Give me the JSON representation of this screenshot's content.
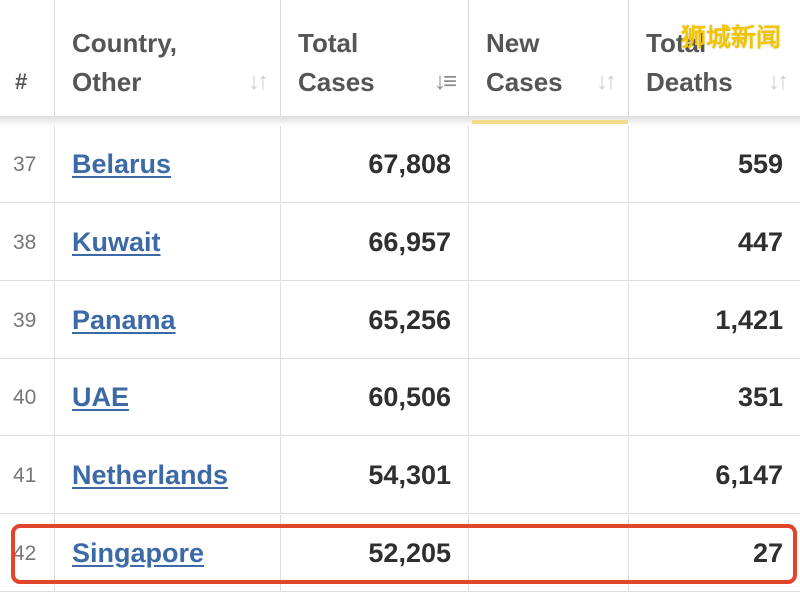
{
  "header": {
    "rank": "#",
    "country": "Country,\nOther",
    "total_cases": "Total\nCases",
    "new_cases": "New\nCases",
    "total_deaths": "Total\nDeaths",
    "sort_icon": "↓↑",
    "sort_icon_active": "↓≡"
  },
  "rows": [
    {
      "rank": "37",
      "country": "Belarus",
      "total_cases": "67,808",
      "new_cases": "",
      "total_deaths": "559"
    },
    {
      "rank": "38",
      "country": "Kuwait",
      "total_cases": "66,957",
      "new_cases": "",
      "total_deaths": "447"
    },
    {
      "rank": "39",
      "country": "Panama",
      "total_cases": "65,256",
      "new_cases": "",
      "total_deaths": "1,421"
    },
    {
      "rank": "40",
      "country": "UAE",
      "total_cases": "60,506",
      "new_cases": "",
      "total_deaths": "351"
    },
    {
      "rank": "41",
      "country": "Netherlands",
      "total_cases": "54,301",
      "new_cases": "",
      "total_deaths": "6,147"
    },
    {
      "rank": "42",
      "country": "Singapore",
      "total_cases": "52,205",
      "new_cases": "",
      "total_deaths": "27"
    }
  ],
  "highlight_color": "#e2452c",
  "link_color": "#3c6aa6",
  "watermark": "狮城新闻"
}
